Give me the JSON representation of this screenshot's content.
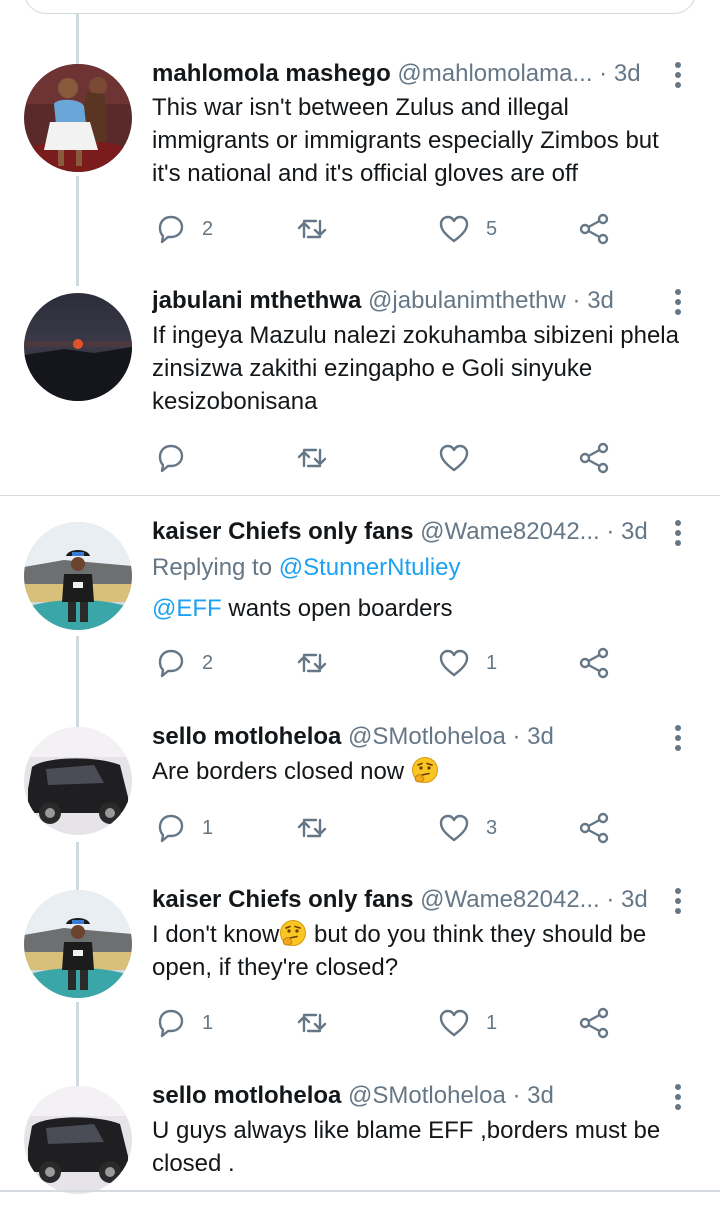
{
  "tweets": [
    {
      "name": "mahlomola mashego",
      "handle": "@mahlomolama...",
      "sep": "·",
      "time": "3d",
      "text": "This war isn't between Zulus and illegal immigrants or immigrants especially Zimbos but it's national and it's official gloves are off",
      "reply_count": "2",
      "retweet_count": "",
      "like_count": "5"
    },
    {
      "name": "jabulani mthethwa",
      "handle": "@jabulanimthethw",
      "sep": "·",
      "time": "3d",
      "text": "If ingeya Mazulu nalezi zokuhamba sibizeni phela zinsizwa zakithi ezingapho e Goli sinyuke kesizobonisana",
      "reply_count": "",
      "retweet_count": "",
      "like_count": ""
    },
    {
      "name": "kaiser Chiefs only fans",
      "handle": "@Wame82042...",
      "sep": "·",
      "time": "3d",
      "replying_prefix": "Replying to ",
      "replying_to": "@StunnerNtuliey",
      "mention": "@EFF",
      "text": " wants open boarders",
      "reply_count": "2",
      "retweet_count": "",
      "like_count": "1"
    },
    {
      "name": "sello motloheloa",
      "handle": "@SMotloheloa",
      "sep": "·",
      "time": "3d",
      "text": "Are borders  closed  now ",
      "reply_count": "1",
      "retweet_count": "",
      "like_count": "3"
    },
    {
      "name": "kaiser Chiefs only fans",
      "handle": "@Wame82042...",
      "sep": "·",
      "time": "3d",
      "text_a": "I don't know",
      "text_b": " but do you think they should be open, if they're closed?",
      "reply_count": "1",
      "retweet_count": "",
      "like_count": "1"
    },
    {
      "name": "sello motloheloa",
      "handle": "@SMotloheloa",
      "sep": "·",
      "time": "3d",
      "text": "U guys  always  like  blame  EFF ,borders  must be closed  ."
    }
  ],
  "icons": {
    "reply": "reply-icon",
    "retweet": "retweet-icon",
    "like": "heart-icon",
    "share": "share-icon",
    "more": "more-vertical-icon",
    "thinking": "thinking-face-emoji"
  },
  "colors": {
    "text": "#14171a",
    "secondary": "#657786",
    "link": "#1da1f2",
    "line": "#cfd9de"
  }
}
